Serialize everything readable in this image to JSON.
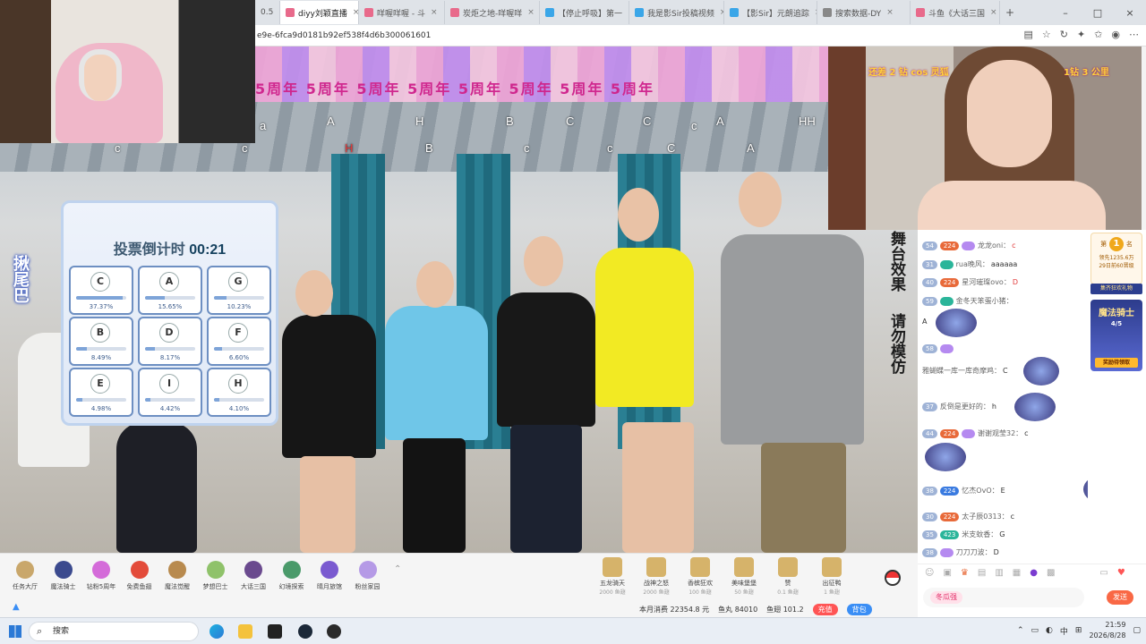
{
  "browser": {
    "tabs": [
      {
        "label": "diyy刘颖直播"
      },
      {
        "label": "咩喔咩喔 - 斗"
      },
      {
        "label": "炭炬之地-咩喔咩"
      },
      {
        "label": "【停止呼吸】第一"
      },
      {
        "label": "我是影Sir投稿视频"
      },
      {
        "label": "【影Sir】元朗追踪"
      },
      {
        "label": "搜索数据-DY"
      },
      {
        "label": "斗鱼《大话三国"
      }
    ],
    "url": "e9e-6fca9d0181b92ef538f4d6b300061601"
  },
  "marquee": {
    "text": "5周年 5周年 5周年 5周年 5周年 5周年 5周年 5周年"
  },
  "danmaku": [
    {
      "text": "a"
    },
    {
      "text": "A"
    },
    {
      "text": "H"
    },
    {
      "text": "B"
    },
    {
      "text": "C"
    },
    {
      "text": "C"
    },
    {
      "text": "c"
    },
    {
      "text": "A"
    },
    {
      "text": "HH"
    },
    {
      "text": "c"
    },
    {
      "text": "H"
    },
    {
      "text": "c"
    },
    {
      "text": "B"
    },
    {
      "text": "c"
    },
    {
      "text": "c"
    },
    {
      "text": "C"
    },
    {
      "text": "A"
    }
  ],
  "vote": {
    "title": "投票倒计时",
    "timer": "00:21",
    "options": [
      {
        "letter": "C",
        "percent": "37.37%",
        "value": 37.37
      },
      {
        "letter": "A",
        "percent": "15.65%",
        "value": 15.65
      },
      {
        "letter": "G",
        "percent": "10.23%",
        "value": 10.23
      },
      {
        "letter": "B",
        "percent": "8.49%",
        "value": 8.49
      },
      {
        "letter": "D",
        "percent": "8.17%",
        "value": 8.17
      },
      {
        "letter": "F",
        "percent": "6.60%",
        "value": 6.6
      },
      {
        "letter": "E",
        "percent": "4.98%",
        "value": 4.98
      },
      {
        "letter": "I",
        "percent": "4.42%",
        "value": 4.42
      },
      {
        "letter": "H",
        "percent": "4.10%",
        "value": 4.1
      }
    ]
  },
  "banners": {
    "left": "揪尾巴",
    "right1": "舞台效果",
    "right2": "请勿模仿"
  },
  "rightcam": {
    "left_text": "还差 2 钻 cos 灵狐",
    "right_text": "1钻 3 公里"
  },
  "chat": [
    {
      "lv": "54",
      "fans": "224",
      "name": "龙龙oni：",
      "msg": "c"
    },
    {
      "lv": "31",
      "fans": "",
      "name": "rua晚风：",
      "msg": "aaaaaa"
    },
    {
      "lv": "40",
      "fans": "224",
      "name": "星河璀璨ovo：",
      "msg": "D"
    },
    {
      "lv": "59",
      "fans": "",
      "name": "金冬天笨蛋小猪：",
      "msg": "A"
    },
    {
      "lv": "58",
      "fans": "",
      "name": "雅蝴蝶一库一库奇摩鸡：",
      "msg": "C"
    },
    {
      "lv": "37",
      "fans": "",
      "name": "反倒是更好的：",
      "msg": "h"
    },
    {
      "lv": "44",
      "fans": "224",
      "name": "谢谢观莹32：",
      "msg": "c"
    },
    {
      "lv": "38",
      "fans": "224",
      "name": "忆杰OvO：",
      "msg": "E"
    },
    {
      "lv": "30",
      "fans": "224",
      "name": "太子辰0313：",
      "msg": "c"
    },
    {
      "lv": "35",
      "fans": "423",
      "name": "米支蚊香：",
      "msg": "G"
    },
    {
      "lv": "38",
      "fans": "",
      "name": "刀刀刀波：",
      "msg": "D"
    }
  ],
  "rank": {
    "label": "第",
    "num": "1",
    "suffix": "名",
    "line1": "领先1235.6万",
    "line2": "29日前60晋级",
    "button": "集齐狂欢礼物"
  },
  "promo": {
    "title": "魔法骑士",
    "progress": "4/5",
    "button": "奖励待领取"
  },
  "bottom_nav": [
    {
      "label": "任务大厅"
    },
    {
      "label": "魔法骑士"
    },
    {
      "label": "钻粉5周年"
    },
    {
      "label": "免费鱼翅"
    },
    {
      "label": "魔法觉醒"
    },
    {
      "label": "梦想巴士"
    },
    {
      "label": "大话三国"
    },
    {
      "label": "幻境探索"
    },
    {
      "label": "晴月旅馆"
    },
    {
      "label": "粉丝家园"
    }
  ],
  "gifts": [
    {
      "name": "五龙骑天",
      "price": "2000 鱼翅"
    },
    {
      "name": "战神之怒",
      "price": "2000 鱼翅"
    },
    {
      "name": "香槟狂欢",
      "price": "100 鱼翅"
    },
    {
      "name": "美味堡堡",
      "price": "50 鱼翅"
    },
    {
      "name": "赞",
      "price": "0.1 鱼翅"
    },
    {
      "name": "出征鸭",
      "price": "1 鱼翅"
    }
  ],
  "assets": {
    "spend": "本月消费 22354.8 元",
    "fish_ball": "鱼丸 84010",
    "fish_fin": "鱼翅 101.2",
    "recharge": "充值",
    "backpack": "背包"
  },
  "chatinput": {
    "tag": "冬瓜强",
    "send": "发送"
  },
  "taskbar": {
    "search": "搜索",
    "time": "21:59",
    "date": "2026/8/28",
    "ime": "中"
  }
}
